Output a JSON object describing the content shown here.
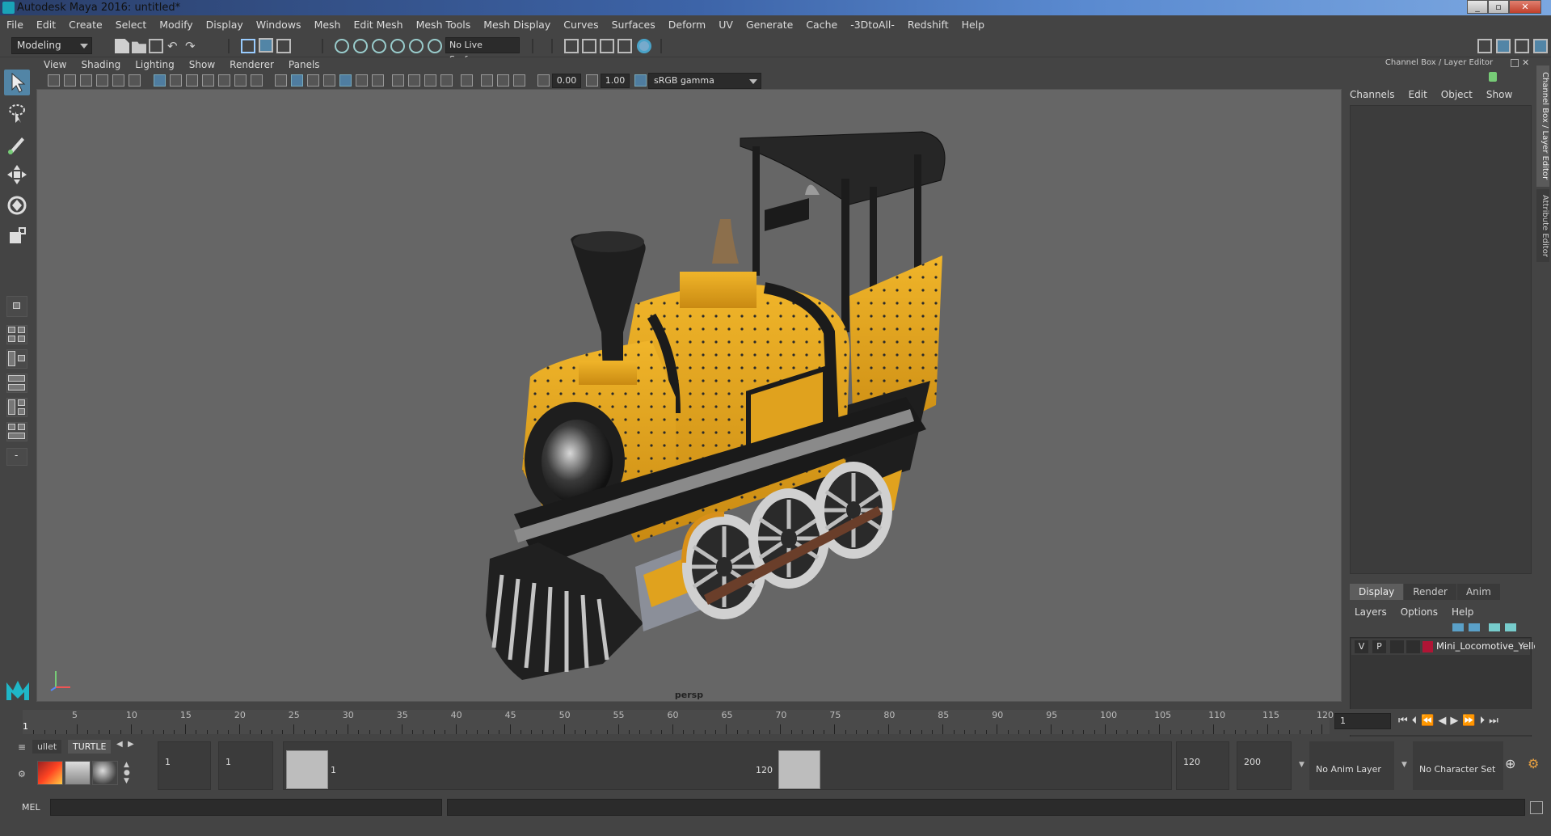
{
  "window": {
    "title": "Autodesk Maya 2016: untitled*"
  },
  "menu": [
    "File",
    "Edit",
    "Create",
    "Select",
    "Modify",
    "Display",
    "Windows",
    "Mesh",
    "Edit Mesh",
    "Mesh Tools",
    "Mesh Display",
    "Curves",
    "Surfaces",
    "Deform",
    "UV",
    "Generate",
    "Cache",
    "-3DtoAll-",
    "Redshift",
    "Help"
  ],
  "status": {
    "mode": "Modeling",
    "live_surface": "No Live Surface"
  },
  "viewport": {
    "menu": [
      "View",
      "Shading",
      "Lighting",
      "Show",
      "Renderer",
      "Panels"
    ],
    "exposure": "0.00",
    "gamma": "1.00",
    "color_space": "sRGB gamma",
    "camera_label": "persp"
  },
  "channel_box": {
    "title": "Channel Box / Layer Editor",
    "menu": [
      "Channels",
      "Edit",
      "Object",
      "Show"
    ],
    "side_tabs": [
      "Channel Box / Layer Editor",
      "Attribute Editor"
    ]
  },
  "layer_editor": {
    "tabs": [
      "Display",
      "Render",
      "Anim"
    ],
    "menu": [
      "Layers",
      "Options",
      "Help"
    ],
    "layers": [
      {
        "v": "V",
        "p": "P",
        "color": "#b01535",
        "name": "Mini_Locomotive_Yellow"
      }
    ]
  },
  "timeline": {
    "ticks": [
      "5",
      "10",
      "15",
      "20",
      "25",
      "30",
      "35",
      "40",
      "45",
      "50",
      "55",
      "60",
      "65",
      "70",
      "75",
      "80",
      "85",
      "90",
      "95",
      "100",
      "105",
      "110",
      "115",
      "120"
    ],
    "current_frame_marker": "1",
    "current_frame": "1"
  },
  "range": {
    "shelf_tabs": [
      "ullet",
      "TURTLE"
    ],
    "start_frame": "1",
    "playback_start": "1",
    "range_start_label": "1",
    "range_end_label": "120",
    "playback_end": "120",
    "end_frame": "200",
    "anim_layer": "No Anim Layer",
    "character_set": "No Character Set"
  },
  "command_line": {
    "label": "MEL"
  },
  "colors": {
    "accent": "#5285a6",
    "model_yellow": "#e0a21e",
    "model_black": "#1e1e1e"
  }
}
